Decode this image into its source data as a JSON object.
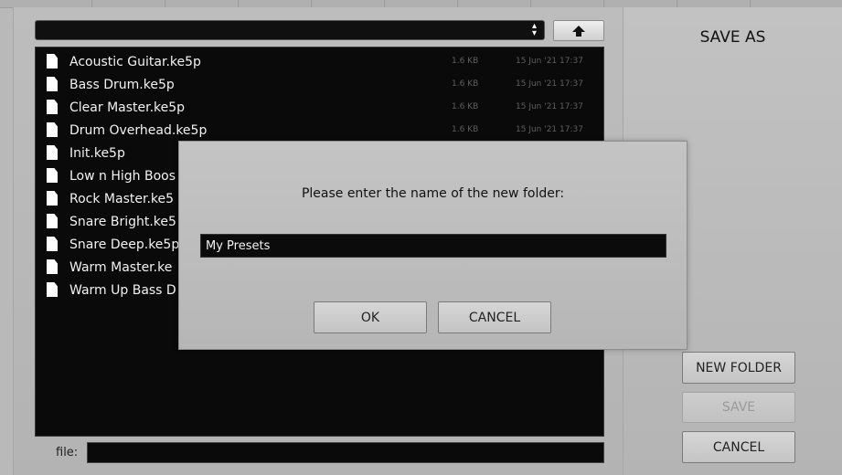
{
  "browser": {
    "path_value": "",
    "files": [
      {
        "name": "Acoustic Guitar.ke5p",
        "size": "1.6 KB",
        "date": "15 Jun '21 17:37"
      },
      {
        "name": "Bass Drum.ke5p",
        "size": "1.6 KB",
        "date": "15 Jun '21 17:37"
      },
      {
        "name": "Clear Master.ke5p",
        "size": "1.6 KB",
        "date": "15 Jun '21 17:37"
      },
      {
        "name": "Drum Overhead.ke5p",
        "size": "1.6 KB",
        "date": "15 Jun '21 17:37"
      },
      {
        "name": "Init.ke5p",
        "size": "",
        "date": ""
      },
      {
        "name": "Low n High Boos",
        "size": "",
        "date": ""
      },
      {
        "name": "Rock Master.ke5",
        "size": "",
        "date": ""
      },
      {
        "name": "Snare Bright.ke5",
        "size": "",
        "date": ""
      },
      {
        "name": "Snare Deep.ke5p",
        "size": "",
        "date": ""
      },
      {
        "name": "Warm Master.ke",
        "size": "",
        "date": ""
      },
      {
        "name": "Warm Up Bass D",
        "size": "",
        "date": ""
      }
    ],
    "file_label": "file:",
    "file_value": ""
  },
  "sidebar": {
    "title": "SAVE AS",
    "new_folder_label": "NEW FOLDER",
    "save_label": "SAVE",
    "cancel_label": "CANCEL"
  },
  "dialog": {
    "prompt": "Please enter the name of the new folder:",
    "folder_name": "My Presets",
    "ok_label": "OK",
    "cancel_label": "CANCEL"
  },
  "icons": {
    "up": "up-arrow-icon",
    "file": "document-icon",
    "select": "select-arrows-icon"
  }
}
